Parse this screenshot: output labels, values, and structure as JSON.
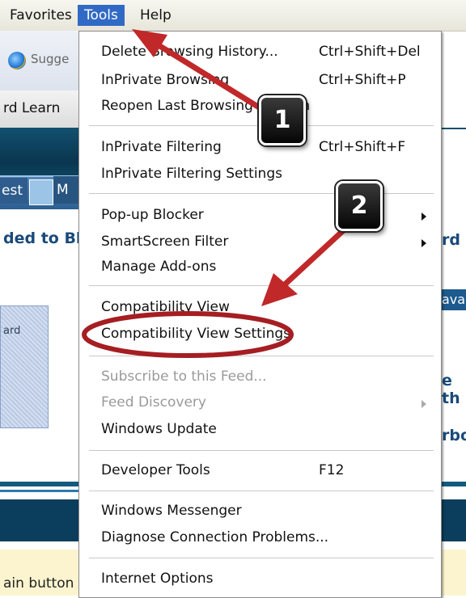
{
  "menubar": {
    "favorites": "Favorites",
    "tools": "Tools",
    "help": "Help"
  },
  "background": {
    "toolbar_suggest": "Sugge",
    "favbar_text": "rd Learn",
    "nav_left": "est",
    "nav_m": "M",
    "headline_left": "ded to Bl",
    "right_rd": "rd",
    "right_ava": "ava",
    "hatch_text": "ard",
    "right_eth": "e th",
    "right_boa": "rboa",
    "bottom_text": "ain button"
  },
  "tools_menu": {
    "items": [
      {
        "label": "Delete Browsing History...",
        "shortcut": "Ctrl+Shift+Del"
      },
      {
        "label": "InPrivate Browsing",
        "shortcut": "Ctrl+Shift+P"
      },
      {
        "label": "Reopen Last Browsing Session",
        "shortcut": ""
      },
      {
        "label": "InPrivate Filtering",
        "shortcut": "Ctrl+Shift+F"
      },
      {
        "label": "InPrivate Filtering Settings",
        "shortcut": ""
      },
      {
        "label": "Pop-up Blocker",
        "shortcut": ""
      },
      {
        "label": "SmartScreen Filter",
        "shortcut": ""
      },
      {
        "label": "Manage Add-ons",
        "shortcut": ""
      },
      {
        "label": "Compatibility View",
        "shortcut": ""
      },
      {
        "label": "Compatibility View Settings",
        "shortcut": ""
      },
      {
        "label": "Subscribe to this Feed...",
        "shortcut": ""
      },
      {
        "label": "Feed Discovery",
        "shortcut": ""
      },
      {
        "label": "Windows Update",
        "shortcut": ""
      },
      {
        "label": "Developer Tools",
        "shortcut": "F12"
      },
      {
        "label": "Windows Messenger",
        "shortcut": ""
      },
      {
        "label": "Diagnose Connection Problems...",
        "shortcut": ""
      },
      {
        "label": "Internet Options",
        "shortcut": ""
      }
    ]
  },
  "annotations": {
    "badge_1": "1",
    "badge_2": "2",
    "arrow_color": "#c0282a",
    "ellipse_color": "#a51e22"
  }
}
